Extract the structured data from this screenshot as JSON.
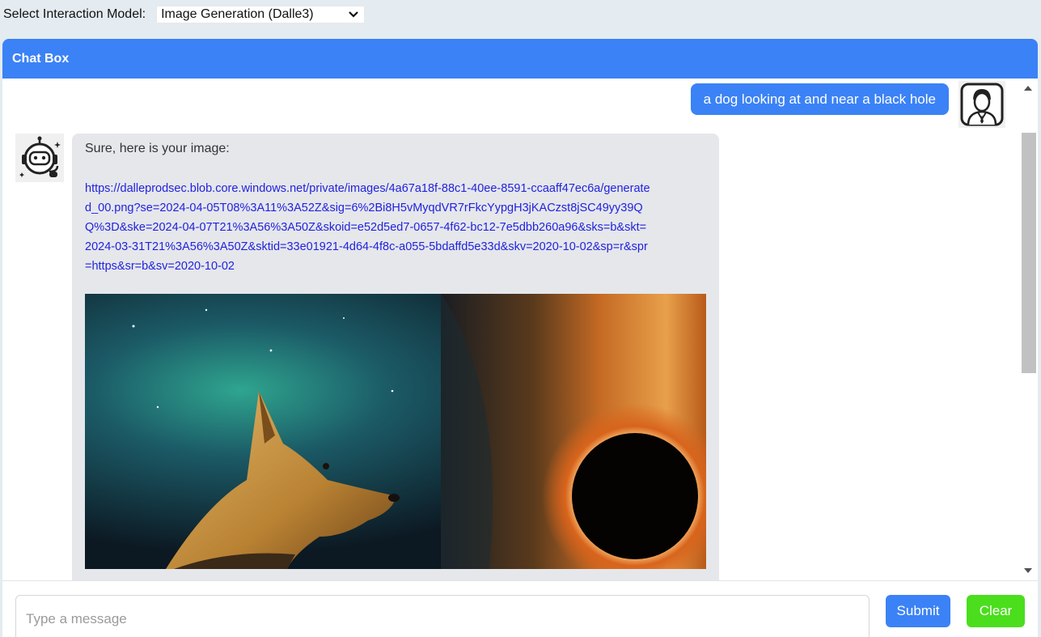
{
  "topbar": {
    "label": "Select Interaction Model:",
    "selected_model": "Image Generation (Dalle3)"
  },
  "chat": {
    "header": "Chat Box",
    "user_message": "a dog looking at and near a black hole",
    "bot_message": {
      "text": "Sure, here is your image:",
      "link": "https://dalleprodsec.blob.core.windows.net/private/images/4a67a18f-88c1-40ee-8591-ccaaff47ec6a/generated_00.png?se=2024-04-05T08%3A11%3A52Z&sig=6%2Bi8H5vMyqdVR7rFkcYypgH3jKACzst8jSC49yy39QQ%3D&ske=2024-04-07T21%3A56%3A50Z&skoid=e52d5ed7-0657-4f62-bc12-7e5dbb260a96&sks=b&skt=2024-03-31T21%3A56%3A50Z&sktid=33e01921-4d64-4f8c-a055-5bdaffd5e33d&skv=2020-10-02&sp=r&spr=https&sr=b&sv=2020-10-02"
    }
  },
  "composer": {
    "placeholder": "Type a message",
    "submit_label": "Submit",
    "clear_label": "Clear"
  },
  "colors": {
    "accent": "#3b82f6",
    "clear_button": "#4ade1c",
    "bot_bubble": "#e5e7eb"
  },
  "icons": {
    "dropdown": "chevron-down-icon",
    "user_avatar": "businessman-avatar-icon",
    "bot_avatar": "robot-headset-avatar-icon"
  }
}
